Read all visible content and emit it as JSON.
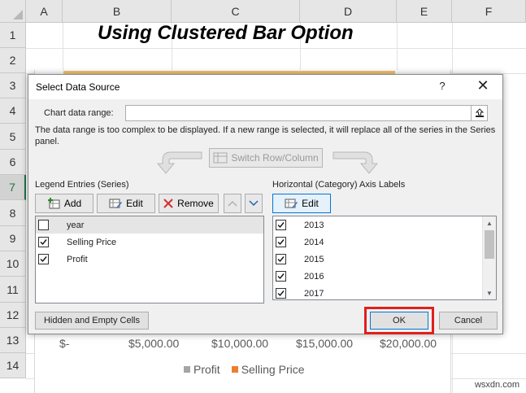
{
  "sheet": {
    "columns": [
      "A",
      "B",
      "C",
      "D",
      "E",
      "F"
    ],
    "rows": [
      "1",
      "2",
      "3",
      "4",
      "5",
      "6",
      "7",
      "8",
      "9",
      "10",
      "11",
      "12",
      "13",
      "14"
    ],
    "selected_row": "7",
    "title": "Using Clustered Bar Option",
    "x_axis_ticks": [
      "$-",
      "$5,000.00",
      "$10,000.00",
      "$15,000.00",
      "$20,000.00"
    ],
    "legend": [
      {
        "label": "Profit",
        "color": "#a5a5a5"
      },
      {
        "label": "Selling Price",
        "color": "#ed7d31"
      }
    ],
    "watermark": "wsxdn.com"
  },
  "dialog": {
    "title": "Select Data Source",
    "help_label": "?",
    "close_label": "✕",
    "chart_range_label": "Chart data range:",
    "chart_range_value": "",
    "range_note": "The data range is too complex to be displayed. If a new range is selected, it will replace all of the series in the Series panel.",
    "switch_button": "Switch Row/Column",
    "legend_entries": {
      "label": "Legend Entries (Series)",
      "add_label": "Add",
      "edit_label": "Edit",
      "remove_label": "Remove",
      "items": [
        {
          "label": "year",
          "checked": false
        },
        {
          "label": "Selling Price",
          "checked": true
        },
        {
          "label": "Profit",
          "checked": true
        }
      ]
    },
    "axis_labels": {
      "label": "Horizontal (Category) Axis Labels",
      "edit_label": "Edit",
      "items": [
        {
          "label": "2013",
          "checked": true
        },
        {
          "label": "2014",
          "checked": true
        },
        {
          "label": "2015",
          "checked": true
        },
        {
          "label": "2016",
          "checked": true
        },
        {
          "label": "2017",
          "checked": true
        }
      ]
    },
    "hidden_cells_button": "Hidden and Empty Cells",
    "ok_button": "OK",
    "cancel_button": "Cancel",
    "highlight_color": "#e0201b"
  }
}
